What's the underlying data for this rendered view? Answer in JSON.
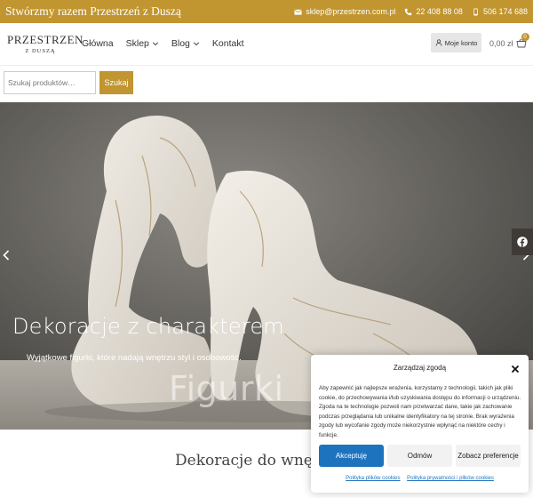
{
  "topbar": {
    "tagline": "Stwórzmy razem Przestrzeń z Duszą",
    "email": "sklep@przestrzen.com.pl",
    "phone1": "22 408 88 08",
    "phone2": "506 174 688"
  },
  "logo": {
    "line1": "PRZESTRZEN",
    "line2": "Z DUSZĄ"
  },
  "nav": {
    "items": [
      {
        "label": "Główna",
        "has_dropdown": false
      },
      {
        "label": "Sklep",
        "has_dropdown": true
      },
      {
        "label": "Blog",
        "has_dropdown": true
      },
      {
        "label": "Kontakt",
        "has_dropdown": false
      }
    ]
  },
  "account": {
    "label": "Moje konto"
  },
  "cart": {
    "amount": "0,00 zł",
    "count": "0"
  },
  "search": {
    "placeholder": "Szukaj produktów…",
    "button": "Szukaj"
  },
  "hero": {
    "title": "Dekoracje z charakterem",
    "subtitle": "Wyjątkowe figurki, które nadają wnętrzu styl i osobowość.",
    "category": "Figurki"
  },
  "section": {
    "heading": "Dekoracje do wnętrz"
  },
  "consent": {
    "title": "Zarządzaj zgodą",
    "body": "Aby zapewnić jak najlepsze wrażenia, korzystamy z technologii, takich jak pliki cookie, do przechowywania i/lub uzyskiwania dostępu do informacji o urządzeniu. Zgoda na te technologie pozwoli nam przetwarzać dane, takie jak zachowanie podczas przeglądania lub unikalne identyfikatory na tej stronie. Brak wyrażenia zgody lub wycofanie zgody może niekorzystnie wpłynąć na niektóre cechy i funkcje.",
    "accept": "Akceptuję",
    "deny": "Odmów",
    "preferences": "Zobacz preferencje",
    "cookie_policy": "Polityka plików cookies",
    "privacy_policy": "Polityka prywatności i plików cookies"
  },
  "colors": {
    "brand_gold": "#c1952f",
    "accept_blue": "#1e73be"
  }
}
